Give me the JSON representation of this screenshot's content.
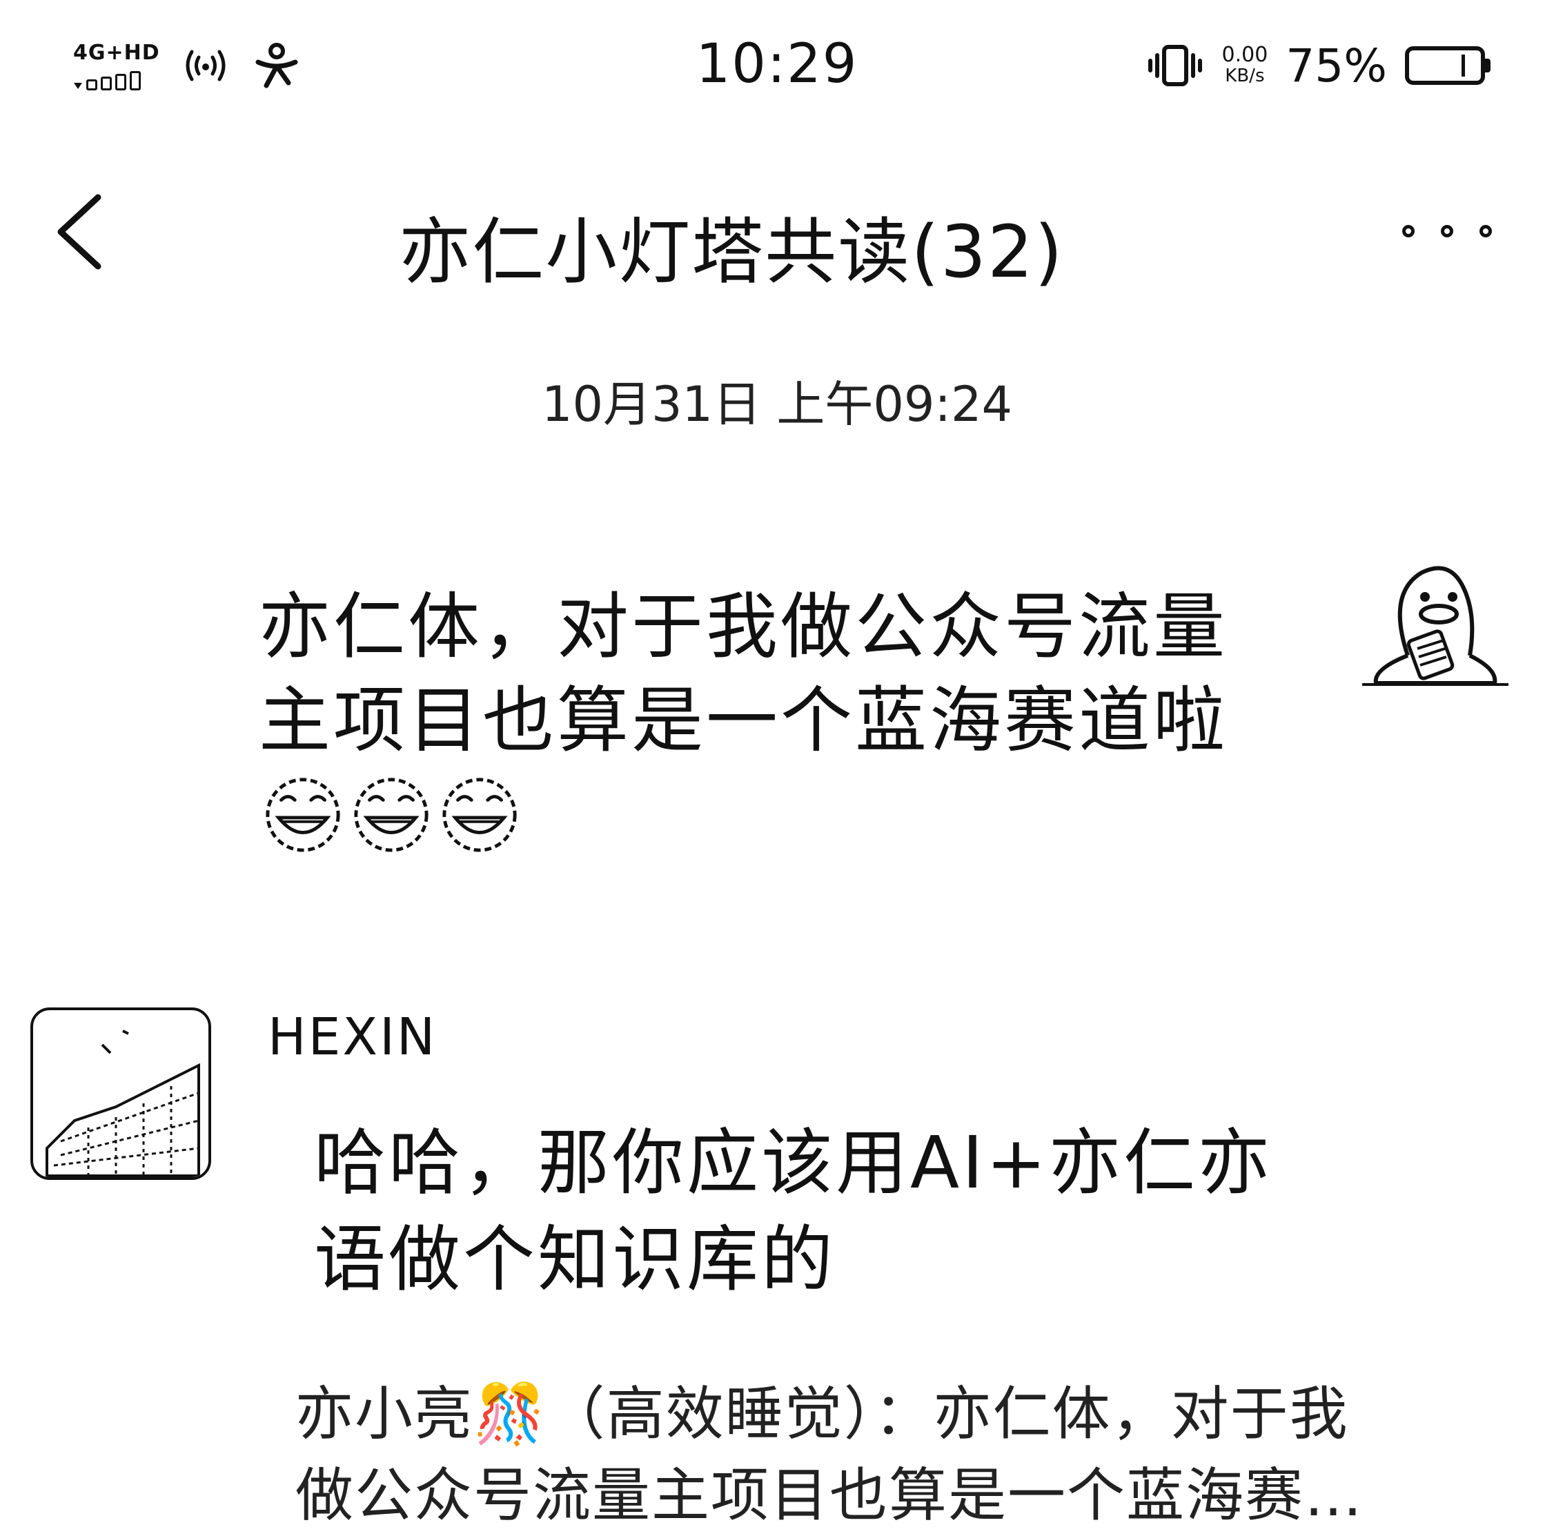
{
  "status_bar": {
    "network": "4G+HD",
    "hotspot_number": "1",
    "time": "10:29",
    "speed_value": "0.00",
    "speed_unit": "KB/s",
    "battery_percent": "75%",
    "battery_level": 0.75,
    "icons": [
      "signal-icon",
      "hotspot-icon",
      "person-icon",
      "vibrate-icon",
      "battery-icon"
    ]
  },
  "header": {
    "title": "亦仁小灯塔共读(32)",
    "back_icon": "chevron-left-icon",
    "more_icon": "more-dots-icon"
  },
  "messages": {
    "timestamp": "10月31日 上午09:24",
    "self_message": {
      "line1": "亦仁体，对于我做公众号流量",
      "line2": "主项目也算是一个蓝海赛道啦",
      "emojis": [
        "laughing-emoji-icon",
        "laughing-emoji-icon",
        "laughing-emoji-icon"
      ]
    },
    "other_message": {
      "sender": "HEXIN",
      "line1": "哈哈，那你应该用AI+亦仁亦",
      "line2": "语做个知识库的",
      "quote_line1": "亦小亮🎊（高效睡觉）：亦仁体，对于我",
      "quote_line2": "做公众号流量主项目也算是一个蓝海赛…"
    }
  }
}
